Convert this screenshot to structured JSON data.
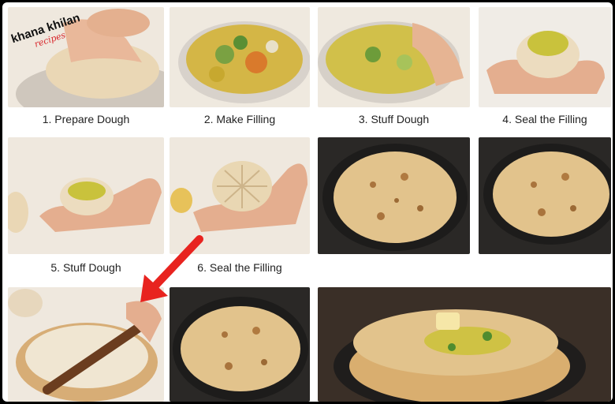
{
  "brand": {
    "logo_text": "khana khilana",
    "logo_subtext": "recipes"
  },
  "steps": [
    {
      "label": "1. Prepare Dough"
    },
    {
      "label": "2. Make Filling"
    },
    {
      "label": "3. Stuff Dough"
    },
    {
      "label": "4. Seal the Filling"
    },
    {
      "label": "5. Stuff Dough"
    },
    {
      "label": "6. Seal the Filling"
    }
  ],
  "colors": {
    "dough": "#ead7b5",
    "filling": "#c9b23a",
    "paratha": "#e2c38c",
    "pan": "#222222",
    "arrow": "#e8231f",
    "brand_red": "#d8262b"
  }
}
